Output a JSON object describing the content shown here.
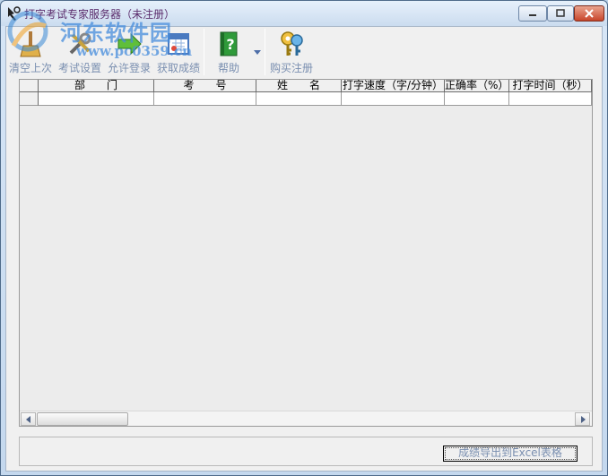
{
  "window": {
    "title": "打字考试专家服务器（未注册）",
    "accent": "#5a2b6b"
  },
  "watermark": {
    "text": "河东软件园",
    "url": "www.pc0359.cn"
  },
  "toolbar": {
    "clear_label": "清空上次",
    "settings_label": "考试设置",
    "allow_login_label": "允许登录",
    "get_scores_label": "获取成绩",
    "help_label": "帮助",
    "buy_label": "购买注册"
  },
  "grid": {
    "columns": [
      "部　　门",
      "考　　号",
      "姓　　名",
      "打字速度（字/分钟）",
      "正确率（%）",
      "打字时间（秒）"
    ]
  },
  "footer": {
    "export_label": "成绩导出到Excel表格"
  },
  "icons": {
    "clear": "broom-icon",
    "settings": "tools-icon",
    "allow_login": "arrow-right-icon",
    "get_scores": "calendar-icon",
    "help": "help-book-icon",
    "buy": "keys-icon"
  }
}
